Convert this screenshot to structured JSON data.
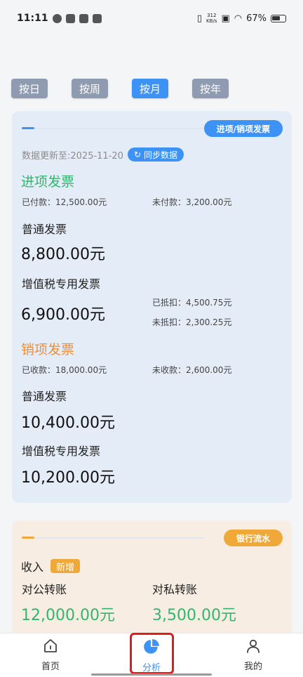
{
  "status_bar": {
    "time": "11:11",
    "net_speed_value": "312",
    "net_speed_unit": "KB/s",
    "battery": "67%"
  },
  "tabs": [
    {
      "label": "按日",
      "active": false
    },
    {
      "label": "按周",
      "active": false
    },
    {
      "label": "按月",
      "active": true
    },
    {
      "label": "按年",
      "active": false
    }
  ],
  "invoice_card": {
    "tag": "进项/销项发票",
    "updated": "数据更新至:2025-11-20",
    "sync_label": "同步数据",
    "input": {
      "title": "进项发票",
      "paid": "已付款：12,500.00元",
      "unpaid": "未付款：3,200.00元",
      "ordinary_label": "普通发票",
      "ordinary_amount": "8,800.00元",
      "vat_label": "增值税专用发票",
      "vat_amount": "6,900.00元",
      "deducted": "已抵扣：4,500.75元",
      "undeducted": "未抵扣：2,300.25元"
    },
    "output": {
      "title": "销项发票",
      "received": "已收款：18,000.00元",
      "unreceived": "未收款：2,600.00元",
      "ordinary_label": "普通发票",
      "ordinary_amount": "10,400.00元",
      "vat_label": "增值税专用发票",
      "vat_amount": "10,200.00元"
    }
  },
  "bank_card": {
    "tag": "银行流水",
    "income_label": "收入",
    "new_badge": "新增",
    "public_label": "对公转账",
    "public_amount": "12,000.00元",
    "private_label": "对私转账",
    "private_amount": "3,500.00元"
  },
  "bottom_nav": [
    {
      "label": "首页",
      "icon": "home-icon",
      "active": false
    },
    {
      "label": "分析",
      "icon": "pie-chart-icon",
      "active": true
    },
    {
      "label": "我的",
      "icon": "user-icon",
      "active": false
    }
  ],
  "colors": {
    "accent": "#3d93f5",
    "green": "#32b56d",
    "orange": "#ee8f3a",
    "highlight": "#e31b1b"
  }
}
